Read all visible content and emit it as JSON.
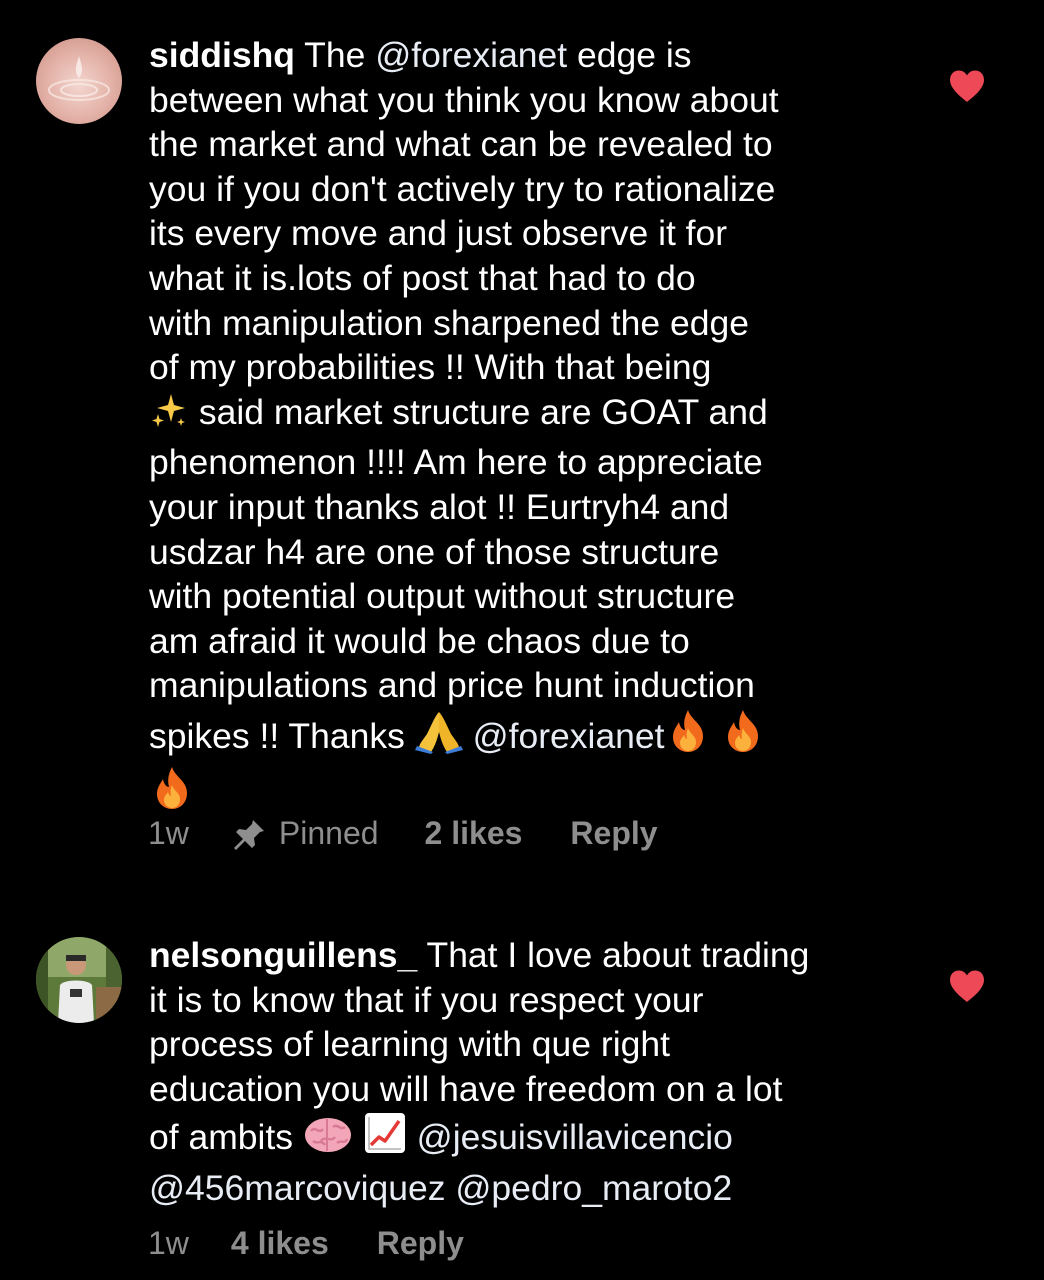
{
  "colors": {
    "background": "#000000",
    "text": "#ffffff",
    "meta": "#8e8e8e",
    "heart": "#ed4956"
  },
  "comments": [
    {
      "username": "siddishq",
      "text_part1": " The ",
      "mention1": "@forexianet",
      "text_part2": " edge is\nbetween what you think you know about\nthe market and what can be revealed to\nyou if you don't actively try to rationalize\nits every move and just observe it for\nwhat it is.lots of  post that  had to do\nwith manipulation sharpened the  edge\nof my probabilities !! With that being\n",
      "emoji_sparkles": "sparkles-icon",
      "text_part3": " said market structure are GOAT and\nphenomenon !!!! Am here to appreciate\nyour input thanks alot !! Eurtryh4 and\nusdzar h4 are one of those structure\nwith potential output without structure\nam afraid it would be chaos due to\nmanipulations and price  hunt induction\nspikes !! Thanks ",
      "emoji_pray": "folded-hands-icon",
      "text_part4": "  ",
      "mention2": "@forexianet",
      "emoji_fire": "fire-icon",
      "time": "1w",
      "pinned_label": "Pinned",
      "likes": "2 likes",
      "reply": "Reply",
      "liked": true
    },
    {
      "username": "nelsonguillens_",
      "text_part1": " That I love about trading\nit is to know that if you respect your\nprocess of learning with que right\neducation you will have freedom on a lot\nof ambits ",
      "emoji_brain": "brain-icon",
      "emoji_chart": "chart-increasing-icon",
      "text_part2": "  ",
      "mention1": "@jesuisvillavicencio",
      "mention2": "@456marcoviquez",
      "mention3": "@pedro_maroto2",
      "time": "1w",
      "likes": "4 likes",
      "reply": "Reply",
      "liked": true
    }
  ]
}
